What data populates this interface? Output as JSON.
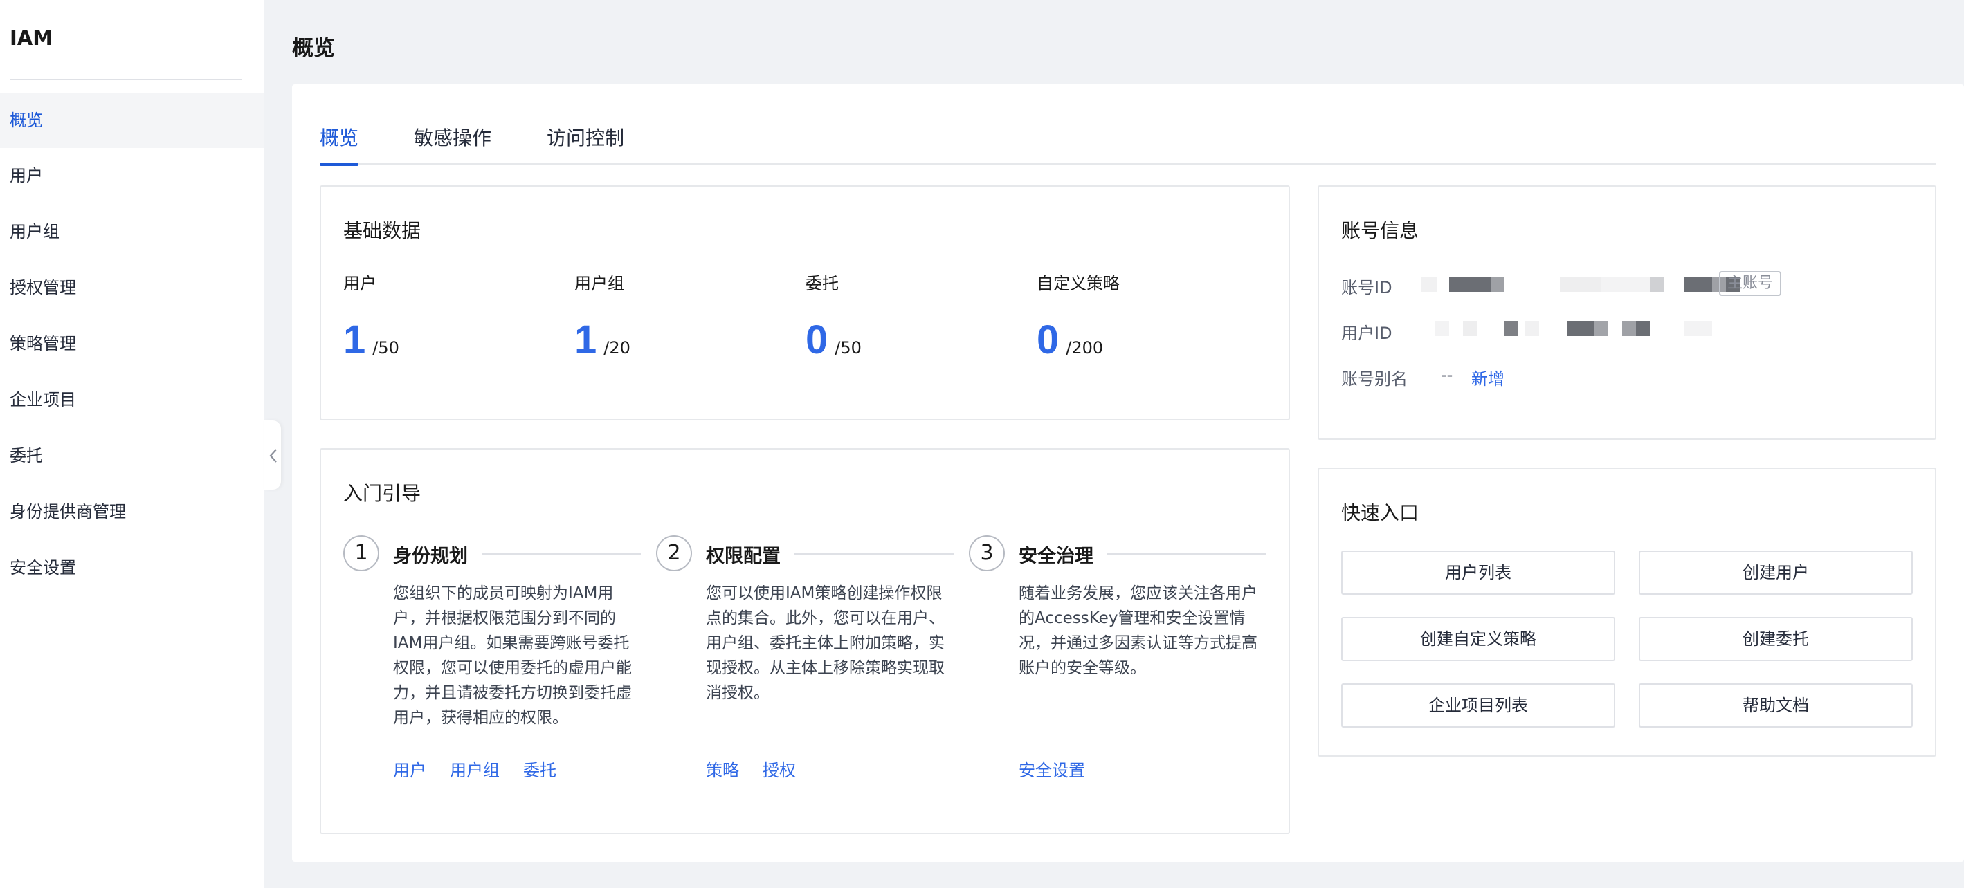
{
  "sidebar": {
    "title": "IAM",
    "items": [
      {
        "label": "概览",
        "active": true
      },
      {
        "label": "用户"
      },
      {
        "label": "用户组"
      },
      {
        "label": "授权管理"
      },
      {
        "label": "策略管理"
      },
      {
        "label": "企业项目"
      },
      {
        "label": "委托"
      },
      {
        "label": "身份提供商管理"
      },
      {
        "label": "安全设置"
      }
    ]
  },
  "page": {
    "title": "概览"
  },
  "tabs": [
    {
      "label": "概览",
      "active": true
    },
    {
      "label": "敏感操作"
    },
    {
      "label": "访问控制"
    }
  ],
  "basic_data": {
    "title": "基础数据",
    "stats": [
      {
        "label": "用户",
        "value": "1",
        "max": "/50"
      },
      {
        "label": "用户组",
        "value": "1",
        "max": "/20"
      },
      {
        "label": "委托",
        "value": "0",
        "max": "/50"
      },
      {
        "label": "自定义策略",
        "value": "0",
        "max": "/200"
      }
    ]
  },
  "guide": {
    "title": "入门引导",
    "steps": [
      {
        "num": "1",
        "title": "身份规划",
        "desc": "您组织下的成员可映射为IAM用户，并根据权限范围分到不同的IAM用户组。如果需要跨账号委托权限，您可以使用委托的虚用户能力，并且请被委托方切换到委托虚用户，获得相应的权限。",
        "links": [
          "用户",
          "用户组",
          "委托"
        ]
      },
      {
        "num": "2",
        "title": "权限配置",
        "desc": "您可以使用IAM策略创建操作权限点的集合。此外，您可以在用户、用户组、委托主体上附加策略，实现授权。从主体上移除策略实现取消授权。",
        "links": [
          "策略",
          "授权"
        ]
      },
      {
        "num": "3",
        "title": "安全治理",
        "desc": "随着业务发展，您应该关注各用户的AccessKey管理和安全设置情况，并通过多因素认证等方式提高账户的安全等级。",
        "links": [
          "安全设置"
        ]
      }
    ]
  },
  "account_info": {
    "title": "账号信息",
    "account_id_label": "账号ID",
    "account_tag": "主账号",
    "user_id_label": "用户ID",
    "alias_label": "账号别名",
    "alias_value": "--",
    "alias_add": "新增",
    "colors": {
      "masked_dark": "#6b6e74",
      "masked_light": "#d8d9dc"
    }
  },
  "quick_entry": {
    "title": "快速入口",
    "buttons": [
      "用户列表",
      "创建用户",
      "创建自定义策略",
      "创建委托",
      "企业项目列表",
      "帮助文档"
    ]
  },
  "theme": {
    "accent": "#2f68e6",
    "text": "#252b3a"
  }
}
